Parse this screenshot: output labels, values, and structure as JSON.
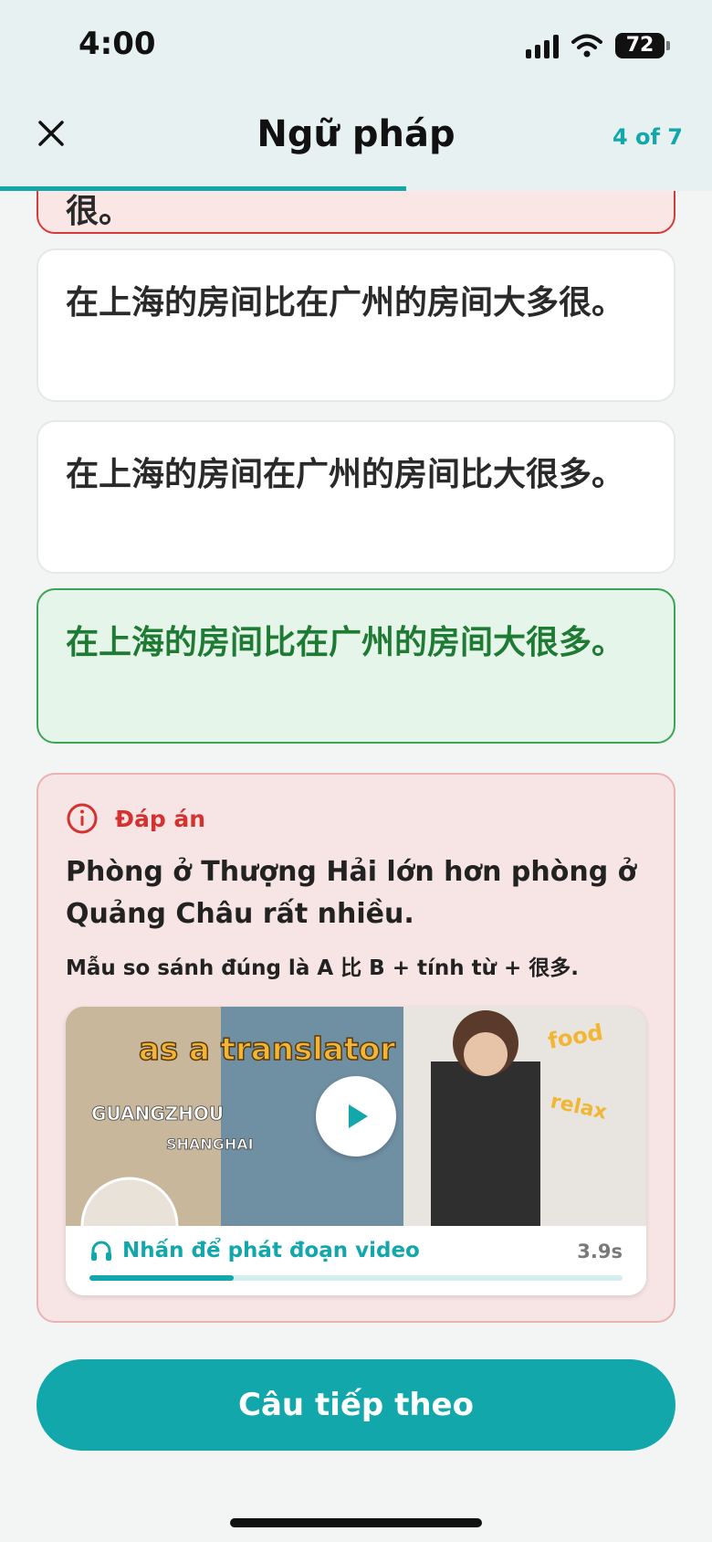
{
  "status_bar": {
    "time": "4:00",
    "battery": "72"
  },
  "header": {
    "title": "Ngữ pháp",
    "progress": "4 of 7",
    "progress_fraction": 0.57
  },
  "options": [
    {
      "text": "在上海的房间比在广州的房间大多很。",
      "state": "wrong"
    },
    {
      "text": "在上海的房间比在广州的房间大多很。",
      "state": "default"
    },
    {
      "text": "在上海的房间在广州的房间比大很多。",
      "state": "default"
    },
    {
      "text": "在上海的房间比在广州的房间大很多。",
      "state": "correct"
    }
  ],
  "answer": {
    "label": "Đáp án",
    "translation": "Phòng ở Thượng Hải lớn hơn phòng ở Quảng Châu rất nhiều.",
    "note": "Mẫu so sánh đúng là A 比 B + tính từ + 很多."
  },
  "video": {
    "hint": "Nhấn để phát đoạn video",
    "duration": "3.9s",
    "progress_fraction": 0.27,
    "thumb_texts": {
      "line1": "as a translator",
      "city1": "GUANGZHOU",
      "city2": "SHANGHAI",
      "tag1": "food",
      "tag2": "relax"
    }
  },
  "next_button": {
    "label": "Câu tiếp theo"
  },
  "colors": {
    "accent": "#12a7ab",
    "wrong": "#d43b3b",
    "correct": "#3aa655"
  }
}
